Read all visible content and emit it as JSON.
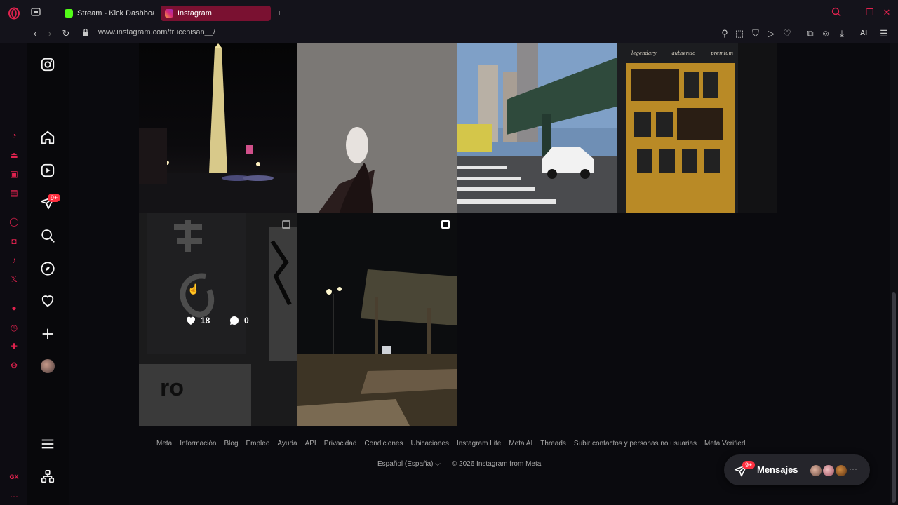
{
  "browser": {
    "tabs": [
      {
        "label": "Stream - Kick Dashboa",
        "active": false
      },
      {
        "label": "Instagram",
        "active": true
      }
    ],
    "url": "www.instagram.com/trucchisan__/",
    "ai_label": "AI",
    "accent": "#e0224e"
  },
  "sidebar": {
    "notifications_badge": "9+"
  },
  "posts": [
    {
      "scene": "obelisk-at-night"
    },
    {
      "scene": "foot-on-asphalt"
    },
    {
      "scene": "city-street-bridge"
    },
    {
      "scene": "basketball-poster-wall",
      "poster_text": [
        "legendary",
        "authentic",
        "premium"
      ]
    },
    {
      "scene": "street-art-wall",
      "likes": "18",
      "comments": "0"
    },
    {
      "scene": "park-at-night"
    }
  ],
  "footer": {
    "links": [
      "Meta",
      "Información",
      "Blog",
      "Empleo",
      "Ayuda",
      "API",
      "Privacidad",
      "Condiciones",
      "Ubicaciones",
      "Instagram Lite",
      "Meta AI",
      "Threads",
      "Subir contactos y personas no usuarias",
      "Meta Verified"
    ],
    "language": "Español (España)",
    "copyright": "© 2026 Instagram from Meta"
  },
  "messages": {
    "label": "Mensajes",
    "badge": "9+",
    "more": "···"
  }
}
